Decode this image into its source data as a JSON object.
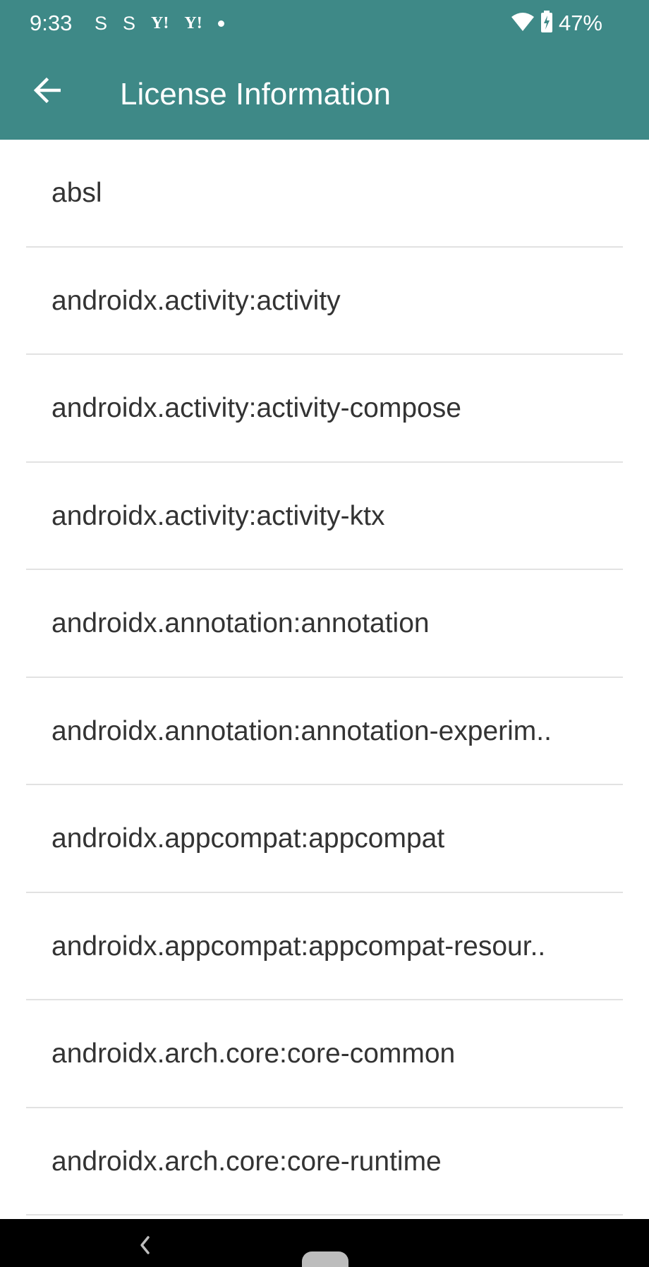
{
  "status_bar": {
    "time": "9:33",
    "notification_icons": [
      "S",
      "S",
      "Y!",
      "Y!"
    ],
    "battery_percent": "47%",
    "icons": [
      "signal-s-icon",
      "signal-s-icon",
      "yahoo-icon",
      "yahoo-icon",
      "dot-icon",
      "wifi-icon",
      "battery-charging-icon"
    ]
  },
  "app_bar": {
    "title": "License Information",
    "back_icon": "arrow-left-icon",
    "background_color": "#3e8987"
  },
  "licenses": [
    {
      "label": "absl"
    },
    {
      "label": "androidx.activity:activity"
    },
    {
      "label": "androidx.activity:activity-compose"
    },
    {
      "label": "androidx.activity:activity-ktx"
    },
    {
      "label": "androidx.annotation:annotation"
    },
    {
      "label": "androidx.annotation:annotation-experim.."
    },
    {
      "label": "androidx.appcompat:appcompat"
    },
    {
      "label": "androidx.appcompat:appcompat-resour.."
    },
    {
      "label": "androidx.arch.core:core-common"
    },
    {
      "label": "androidx.arch.core:core-runtime"
    }
  ],
  "nav_bar": {
    "back_icon": "chevron-left-icon",
    "home_icon": "home-pill-icon"
  }
}
